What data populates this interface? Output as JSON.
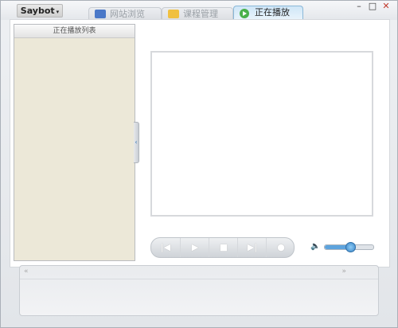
{
  "app": {
    "menu_label": "Saybot",
    "caret": "▾"
  },
  "window_controls": {
    "minimize": "–",
    "maximize": "□",
    "close": "✕"
  },
  "tabs": [
    {
      "label": "网站浏览",
      "icon": "computer-icon",
      "active": false
    },
    {
      "label": "课程管理",
      "icon": "folder-icon",
      "active": false
    },
    {
      "label": "正在播放",
      "icon": "play-circle-icon",
      "active": true
    }
  ],
  "playlist": {
    "title": "正在播放列表",
    "collapse_glyph": "‹"
  },
  "player": {
    "buttons": {
      "prev": "|◀",
      "play": "▶",
      "stop": "■",
      "next": "▶|",
      "record": "●"
    },
    "volume_icon": "🔈",
    "volume_level": 0.5
  },
  "bottom": {
    "left_arrow": "«",
    "right_arrow": "»"
  },
  "colors": {
    "accent": "#5da3dd",
    "playlist_bg": "#ece8d8",
    "active_tab": "#cfe6f7"
  }
}
